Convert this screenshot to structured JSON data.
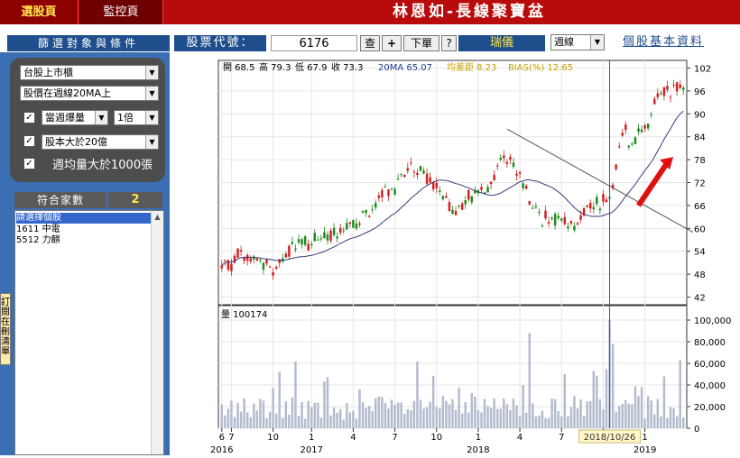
{
  "tabs": [
    {
      "label": "選股頁"
    },
    {
      "label": "監控頁"
    }
  ],
  "app_title": "林恩如-長線聚寶盆",
  "conditions": {
    "header": "篩選對象與條件",
    "market": "台股上市櫃",
    "price_condition": "股價在週線20MA上",
    "weekly_volume": "當週爆量",
    "multiplier": "1倍",
    "capital": "股本大於20億",
    "avg_volume": "週均量大於1000張",
    "check_mark": "✓"
  },
  "results": {
    "count_label": "符合家數",
    "count": "2",
    "items": [
      "請選擇個股",
      "1611  中電",
      "5512  力麒"
    ]
  },
  "side_tab": "訂閱在刪清單",
  "search": {
    "label": "股票代號：",
    "code": "6176",
    "query_btn": "查",
    "add_btn": "+",
    "list_btn": "下單",
    "help_btn": "?",
    "stock_name": "瑞儀",
    "period": "週線",
    "info_link": "個股基本資料"
  },
  "chart_data": {
    "type": "candlestick",
    "info": {
      "open": "開 68.5",
      "high": "高 79.3",
      "low": "低 67.9",
      "close": "收 73.3",
      "ma": "20MA 65.07",
      "gap": "均差距 8.23",
      "bias": "BIAS(%) 12.65"
    },
    "volume_label": "量 100174",
    "crosshair_date": "2018/10/26",
    "price_ylim": [
      40,
      104
    ],
    "price_ticks": [
      42,
      48,
      54,
      60,
      66,
      72,
      78,
      84,
      90,
      96,
      102
    ],
    "volume_ylim": [
      0,
      110000
    ],
    "volume_ticks": [
      0,
      20000,
      40000,
      60000,
      80000,
      100000
    ],
    "volume_tick_labels": [
      "0",
      "20,000",
      "40,000",
      "60,000",
      "80,000",
      "100,000"
    ],
    "x_ticks": [
      {
        "i": 0,
        "label": "6"
      },
      {
        "i": 3,
        "label": "7"
      },
      {
        "i": 16,
        "label": "10"
      },
      {
        "i": 28,
        "label": "1"
      },
      {
        "i": 41,
        "label": "4"
      },
      {
        "i": 54,
        "label": "7"
      },
      {
        "i": 67,
        "label": "10"
      },
      {
        "i": 80,
        "label": "1"
      },
      {
        "i": 93,
        "label": "4"
      },
      {
        "i": 106,
        "label": "7"
      },
      {
        "i": 119,
        "label": "10"
      },
      {
        "i": 132,
        "label": "1"
      }
    ],
    "year_labels": [
      {
        "i": 0,
        "label": "2016"
      },
      {
        "i": 28,
        "label": "2017"
      },
      {
        "i": 80,
        "label": "2018"
      },
      {
        "i": 132,
        "label": "2019"
      }
    ],
    "crosshair_index": 121,
    "colors": {
      "up": "#d42020",
      "down": "#1e8a1e",
      "ma": "#3a3a7a",
      "volume": "#b3bccd",
      "crosshair": "#3a4bd8",
      "arrow": "#e01010",
      "trend": "#555555"
    },
    "price_keyframes": [
      [
        0,
        50
      ],
      [
        3,
        51
      ],
      [
        5,
        53
      ],
      [
        12,
        51.5
      ],
      [
        16,
        49
      ],
      [
        19,
        52
      ],
      [
        22,
        55
      ],
      [
        26,
        56
      ],
      [
        30,
        57
      ],
      [
        34,
        58
      ],
      [
        38,
        61
      ],
      [
        42,
        62
      ],
      [
        46,
        64
      ],
      [
        50,
        68
      ],
      [
        54,
        71
      ],
      [
        58,
        76
      ],
      [
        62,
        75
      ],
      [
        66,
        72
      ],
      [
        70,
        66
      ],
      [
        72,
        64
      ],
      [
        76,
        67
      ],
      [
        80,
        70
      ],
      [
        84,
        72
      ],
      [
        88,
        79
      ],
      [
        91,
        77
      ],
      [
        94,
        72
      ],
      [
        96,
        68
      ],
      [
        98,
        64
      ],
      [
        102,
        62
      ],
      [
        106,
        63
      ],
      [
        110,
        61
      ],
      [
        114,
        65
      ],
      [
        118,
        67
      ],
      [
        121,
        68
      ],
      [
        124,
        82
      ],
      [
        126,
        86
      ],
      [
        128,
        81
      ],
      [
        130,
        86
      ],
      [
        133,
        88
      ],
      [
        136,
        95
      ],
      [
        139,
        96
      ]
    ],
    "trendline": [
      [
        89,
        86
      ],
      [
        147,
        59
      ]
    ]
  }
}
